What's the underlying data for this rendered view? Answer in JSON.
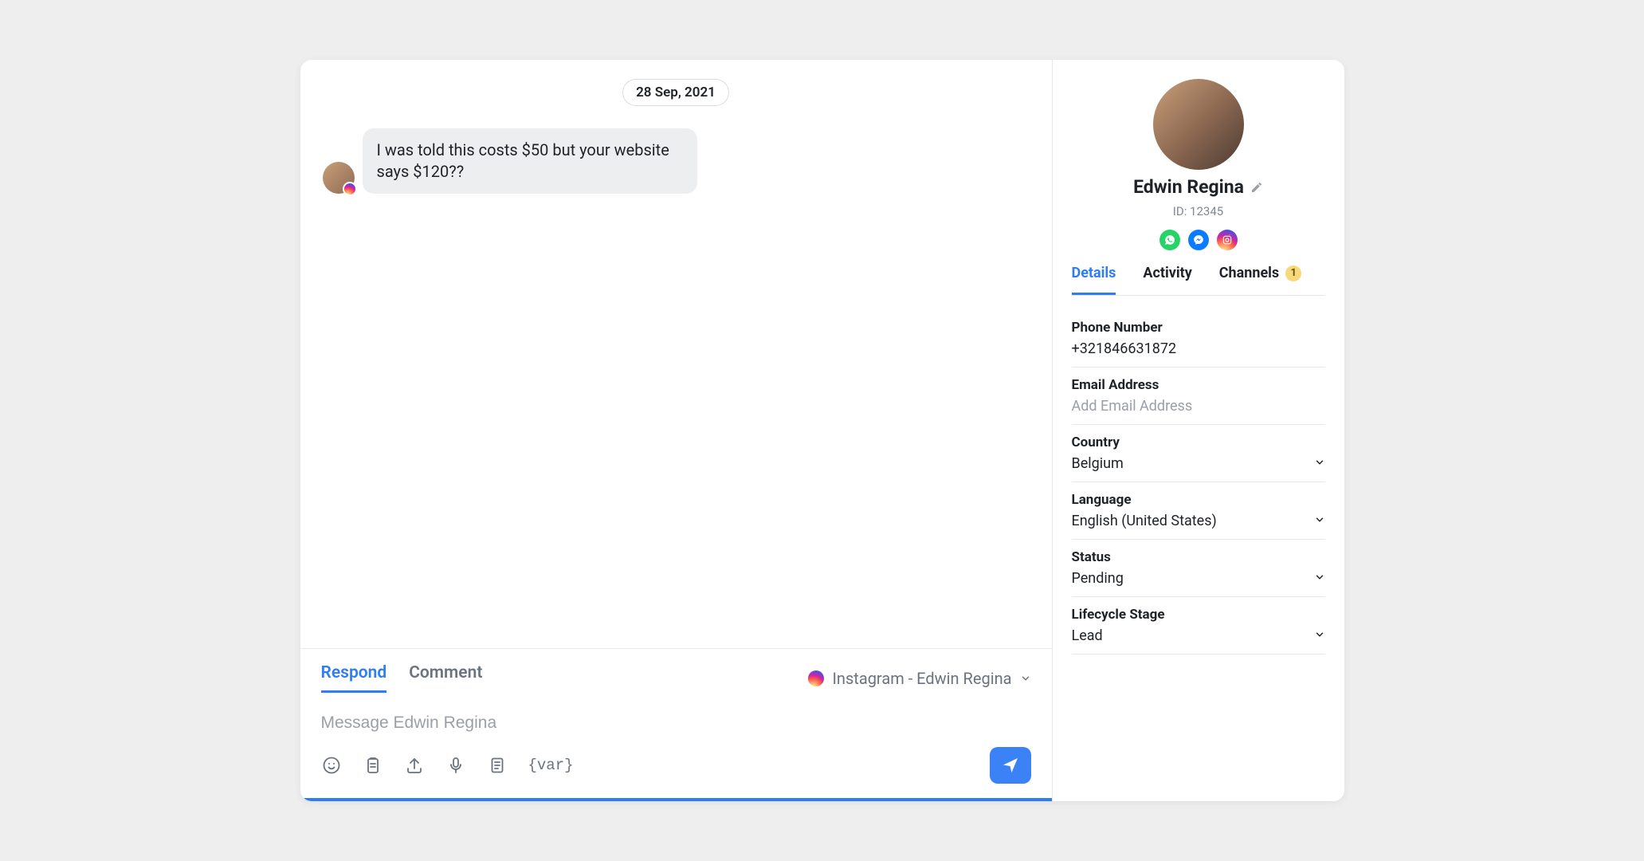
{
  "chat": {
    "date": "28 Sep, 2021",
    "messages": [
      {
        "text": "I was told this costs $50 but your website says $120??",
        "channel": "instagram"
      }
    ]
  },
  "composer": {
    "tabs": {
      "respond": "Respond",
      "comment": "Comment"
    },
    "channel_label": "Instagram - Edwin Regina",
    "input_placeholder": "Message Edwin Regina",
    "var_label": "{var}"
  },
  "profile": {
    "name": "Edwin Regina",
    "id_label": "ID: 12345",
    "channels_badge": "1",
    "tabs": {
      "details": "Details",
      "activity": "Activity",
      "channels": "Channels"
    },
    "fields": {
      "phone": {
        "label": "Phone Number",
        "value": "+321846631872"
      },
      "email": {
        "label": "Email Address",
        "placeholder": "Add Email Address"
      },
      "country": {
        "label": "Country",
        "value": "Belgium"
      },
      "language": {
        "label": "Language",
        "value": "English (United States)"
      },
      "status": {
        "label": "Status",
        "value": "Pending"
      },
      "lifecycle": {
        "label": "Lifecycle Stage",
        "value": "Lead"
      }
    }
  }
}
